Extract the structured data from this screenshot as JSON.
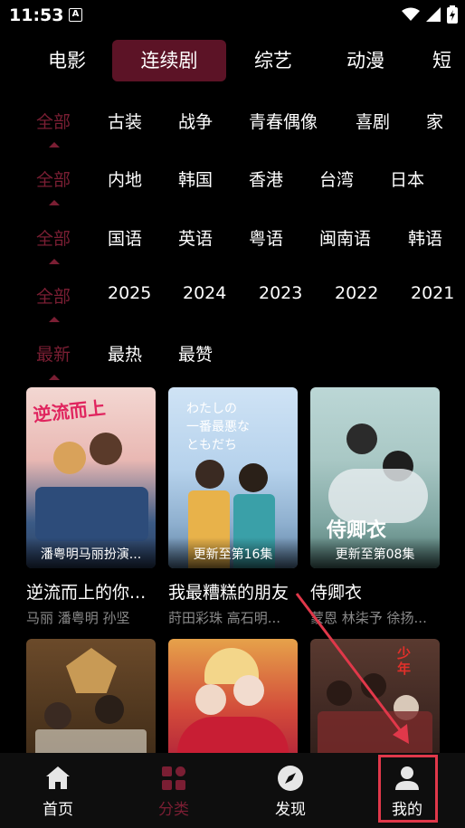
{
  "status_bar": {
    "time": "11:53",
    "notification_icon": "A"
  },
  "top_tabs": [
    {
      "label": "电影",
      "active": false
    },
    {
      "label": "连续剧",
      "active": true
    },
    {
      "label": "综艺",
      "active": false
    },
    {
      "label": "动漫",
      "active": false
    },
    {
      "label": "短",
      "active": false
    }
  ],
  "filters": {
    "genre": [
      "全部",
      "古装",
      "战争",
      "青春偶像",
      "喜剧",
      "家"
    ],
    "region": [
      "全部",
      "内地",
      "韩国",
      "香港",
      "台湾",
      "日本"
    ],
    "language": [
      "全部",
      "国语",
      "英语",
      "粤语",
      "闽南语",
      "韩语"
    ],
    "year": [
      "全部",
      "2025",
      "2024",
      "2023",
      "2022",
      "2021"
    ],
    "sort": [
      "最新",
      "最热",
      "最赞"
    ]
  },
  "cards": [
    {
      "title": "逆流而上的你...",
      "caption": "潘粤明马丽扮演...",
      "actors": "马丽 潘粤明 孙坚"
    },
    {
      "title": "我最糟糕的朋友",
      "caption": "更新至第16集",
      "actors": "莳田彩珠 高石明..."
    },
    {
      "title": "侍卿衣",
      "caption": "更新至第08集",
      "actors": "蒙恩 林柒予 徐扬..."
    },
    {
      "title": "",
      "caption": "",
      "actors": ""
    },
    {
      "title": "",
      "caption": "",
      "actors": ""
    },
    {
      "title": "",
      "caption": "",
      "actors": ""
    }
  ],
  "bottom_nav": [
    {
      "label": "首页",
      "icon": "home-icon",
      "active": false
    },
    {
      "label": "分类",
      "icon": "category-icon",
      "active": true
    },
    {
      "label": "发现",
      "icon": "compass-icon",
      "active": false
    },
    {
      "label": "我的",
      "icon": "user-icon",
      "active": false
    }
  ],
  "colors": {
    "accent": "#7a1e33",
    "tab_active_bg": "#5c1326",
    "annotation": "#e0384a"
  }
}
